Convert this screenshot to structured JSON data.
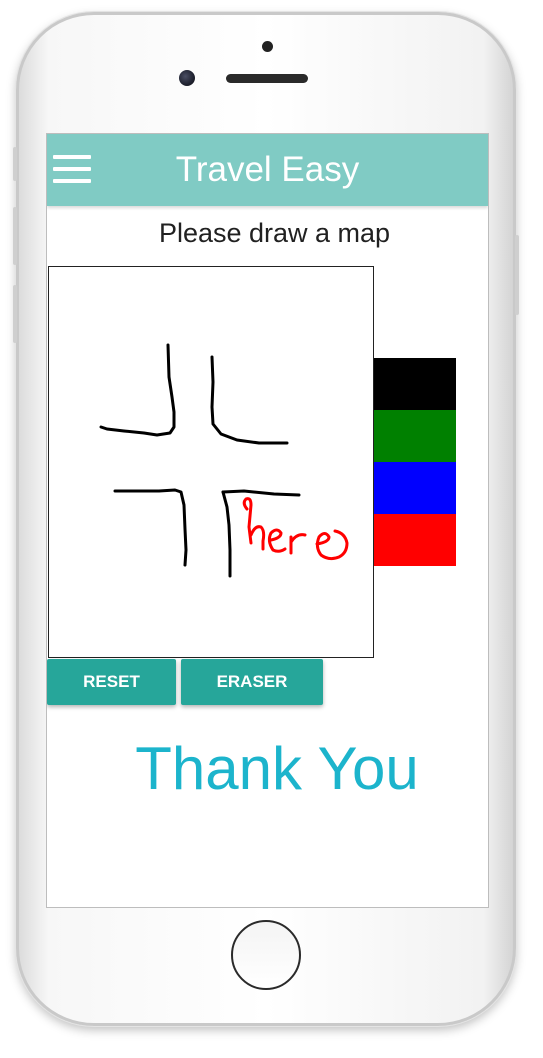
{
  "app_bar": {
    "title": "Travel Easy",
    "menu_icon": "hamburger-menu-icon",
    "background_color": "#80cbc4"
  },
  "instruction": "Please draw a map",
  "drawing": {
    "handwritten_text": "here",
    "stroke_colors": [
      "#000000",
      "#ff0000"
    ]
  },
  "color_palette": [
    {
      "name": "black",
      "color": "#000000"
    },
    {
      "name": "green",
      "color": "#008000"
    },
    {
      "name": "blue",
      "color": "#0000ff"
    },
    {
      "name": "red",
      "color": "#ff0000"
    }
  ],
  "buttons": {
    "reset_label": "RESET",
    "eraser_label": "ERASER",
    "color": "#26a69a"
  },
  "closing_message": "Thank You",
  "closing_message_color": "#1cb4cc"
}
